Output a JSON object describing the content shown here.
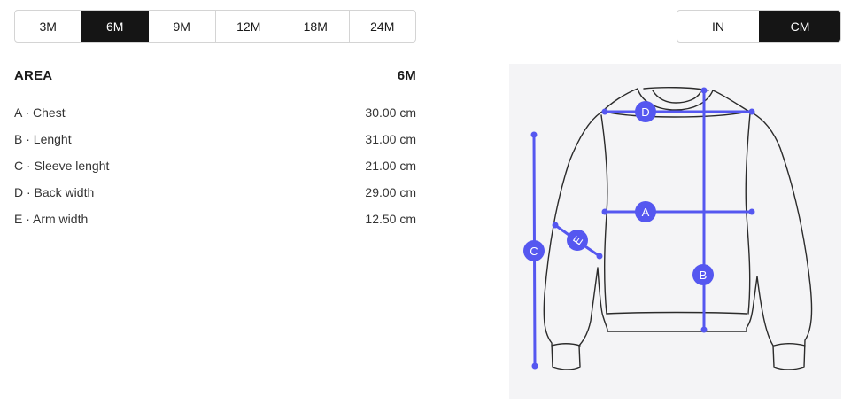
{
  "size_selector": {
    "options": [
      "3M",
      "6M",
      "9M",
      "12M",
      "18M",
      "24M"
    ],
    "selected": "6M"
  },
  "unit_selector": {
    "options": [
      "IN",
      "CM"
    ],
    "selected": "CM"
  },
  "table": {
    "header_left": "AREA",
    "header_right": "6M",
    "rows": [
      {
        "label": "A · Chest",
        "value": "30.00 cm"
      },
      {
        "label": "B · Lenght",
        "value": "31.00 cm"
      },
      {
        "label": "C · Sleeve lenght",
        "value": "21.00 cm"
      },
      {
        "label": "D · Back width",
        "value": "29.00 cm"
      },
      {
        "label": "E · Arm width",
        "value": "12.50 cm"
      }
    ]
  },
  "diagram": {
    "markers": [
      "A",
      "B",
      "C",
      "D",
      "E"
    ],
    "accent_color": "#5557f0",
    "outline_color": "#2b2b2b",
    "background_color": "#f4f4f6"
  }
}
